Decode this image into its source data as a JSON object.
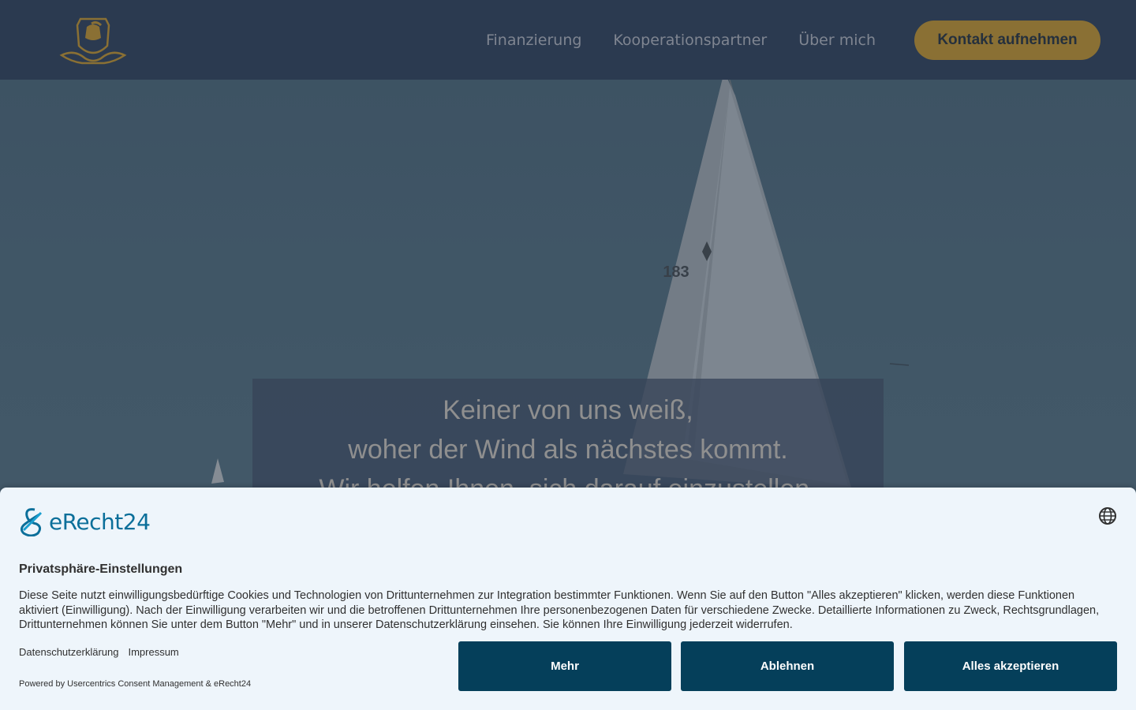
{
  "header": {
    "logo_icon": "helmet-crest-logo",
    "nav": [
      "Finanzierung",
      "Kooperationspartner",
      "Über mich"
    ],
    "cta_label": "Kontakt aufnehmen",
    "colors": {
      "bg": "#2b3a50",
      "accent": "#8a7034"
    }
  },
  "hero": {
    "sail_number": "183",
    "quote": [
      "Keiner von uns weiß,",
      "woher der Wind als nächstes kommt.",
      "Wir helfen Ihnen, sich darauf einzustellen."
    ]
  },
  "consent": {
    "brand_name": "eRecht24",
    "brand_icon": "erecht24-logo-icon",
    "language_icon": "globe-icon",
    "title": "Privatsphäre-Einstellungen",
    "body": "Diese Seite nutzt einwilligungsbedürftige Cookies und Technologien von Drittunternehmen zur Integration bestimmter Funktionen. Wenn Sie auf den Button \"Alles akzeptieren\" klicken, werden diese Funktionen aktiviert (Einwilligung). Nach der Einwilligung verarbeiten wir und die betroffenen Drittunternehmen Ihre personenbezogenen Daten für verschiedene Zwecke. Detaillierte Informationen zu Zweck, Rechtsgrundlagen, Drittunternehmen können Sie unter dem Button \"Mehr\" und in unserer Datenschutzerklärung einsehen. Sie können Ihre Einwilligung jederzeit widerrufen.",
    "links": [
      "Datenschutzerklärung",
      "Impressum"
    ],
    "powered_by": "Powered by Usercentrics Consent Management & eRecht24",
    "buttons": {
      "more": "Mehr",
      "decline": "Ablehnen",
      "accept": "Alles akzeptieren"
    },
    "colors": {
      "bg": "#eef5fb",
      "button": "#053f5a",
      "brand": "#0b6f9a"
    }
  }
}
